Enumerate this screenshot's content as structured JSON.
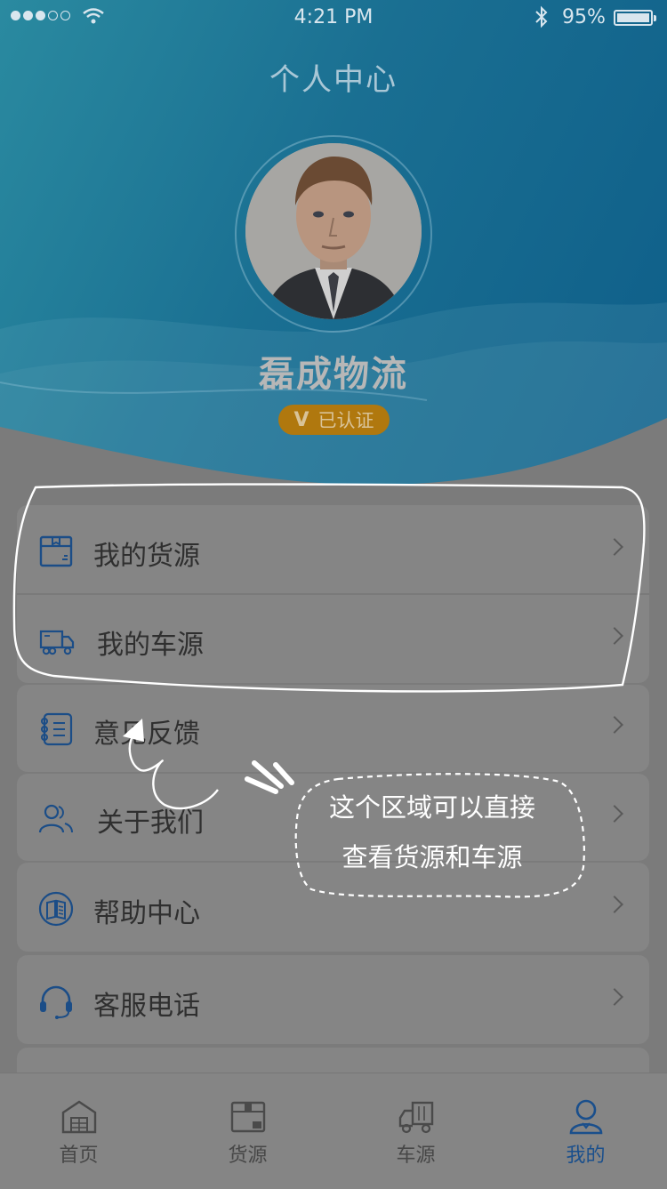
{
  "status_bar": {
    "time": "4:21 PM",
    "battery": "95%"
  },
  "header": {
    "title": "个人中心"
  },
  "profile": {
    "company": "磊成物流",
    "badge_mark": "V",
    "badge_text": "已认证"
  },
  "menu": {
    "items": [
      {
        "label": "我的货源",
        "icon": "package-box-icon"
      },
      {
        "label": "我的车源",
        "icon": "truck-icon"
      },
      {
        "label": "意见反馈",
        "icon": "feedback-list-icon"
      },
      {
        "label": "关于我们",
        "icon": "users-icon"
      },
      {
        "label": "帮助中心",
        "icon": "help-book-icon"
      },
      {
        "label": "客服电话",
        "icon": "headset-icon"
      }
    ]
  },
  "annotation": {
    "line1": "这个区域可以直接",
    "line2": "查看货源和车源"
  },
  "tabbar": {
    "tabs": [
      {
        "label": "首页",
        "icon": "warehouse-icon"
      },
      {
        "label": "货源",
        "icon": "goods-box-icon"
      },
      {
        "label": "车源",
        "icon": "truck-icon"
      },
      {
        "label": "我的",
        "icon": "person-icon"
      }
    ],
    "active": "我的"
  },
  "colors": {
    "brand": "#0e5e89",
    "accent": "#1a4f8c",
    "badge": "#b0780e"
  }
}
